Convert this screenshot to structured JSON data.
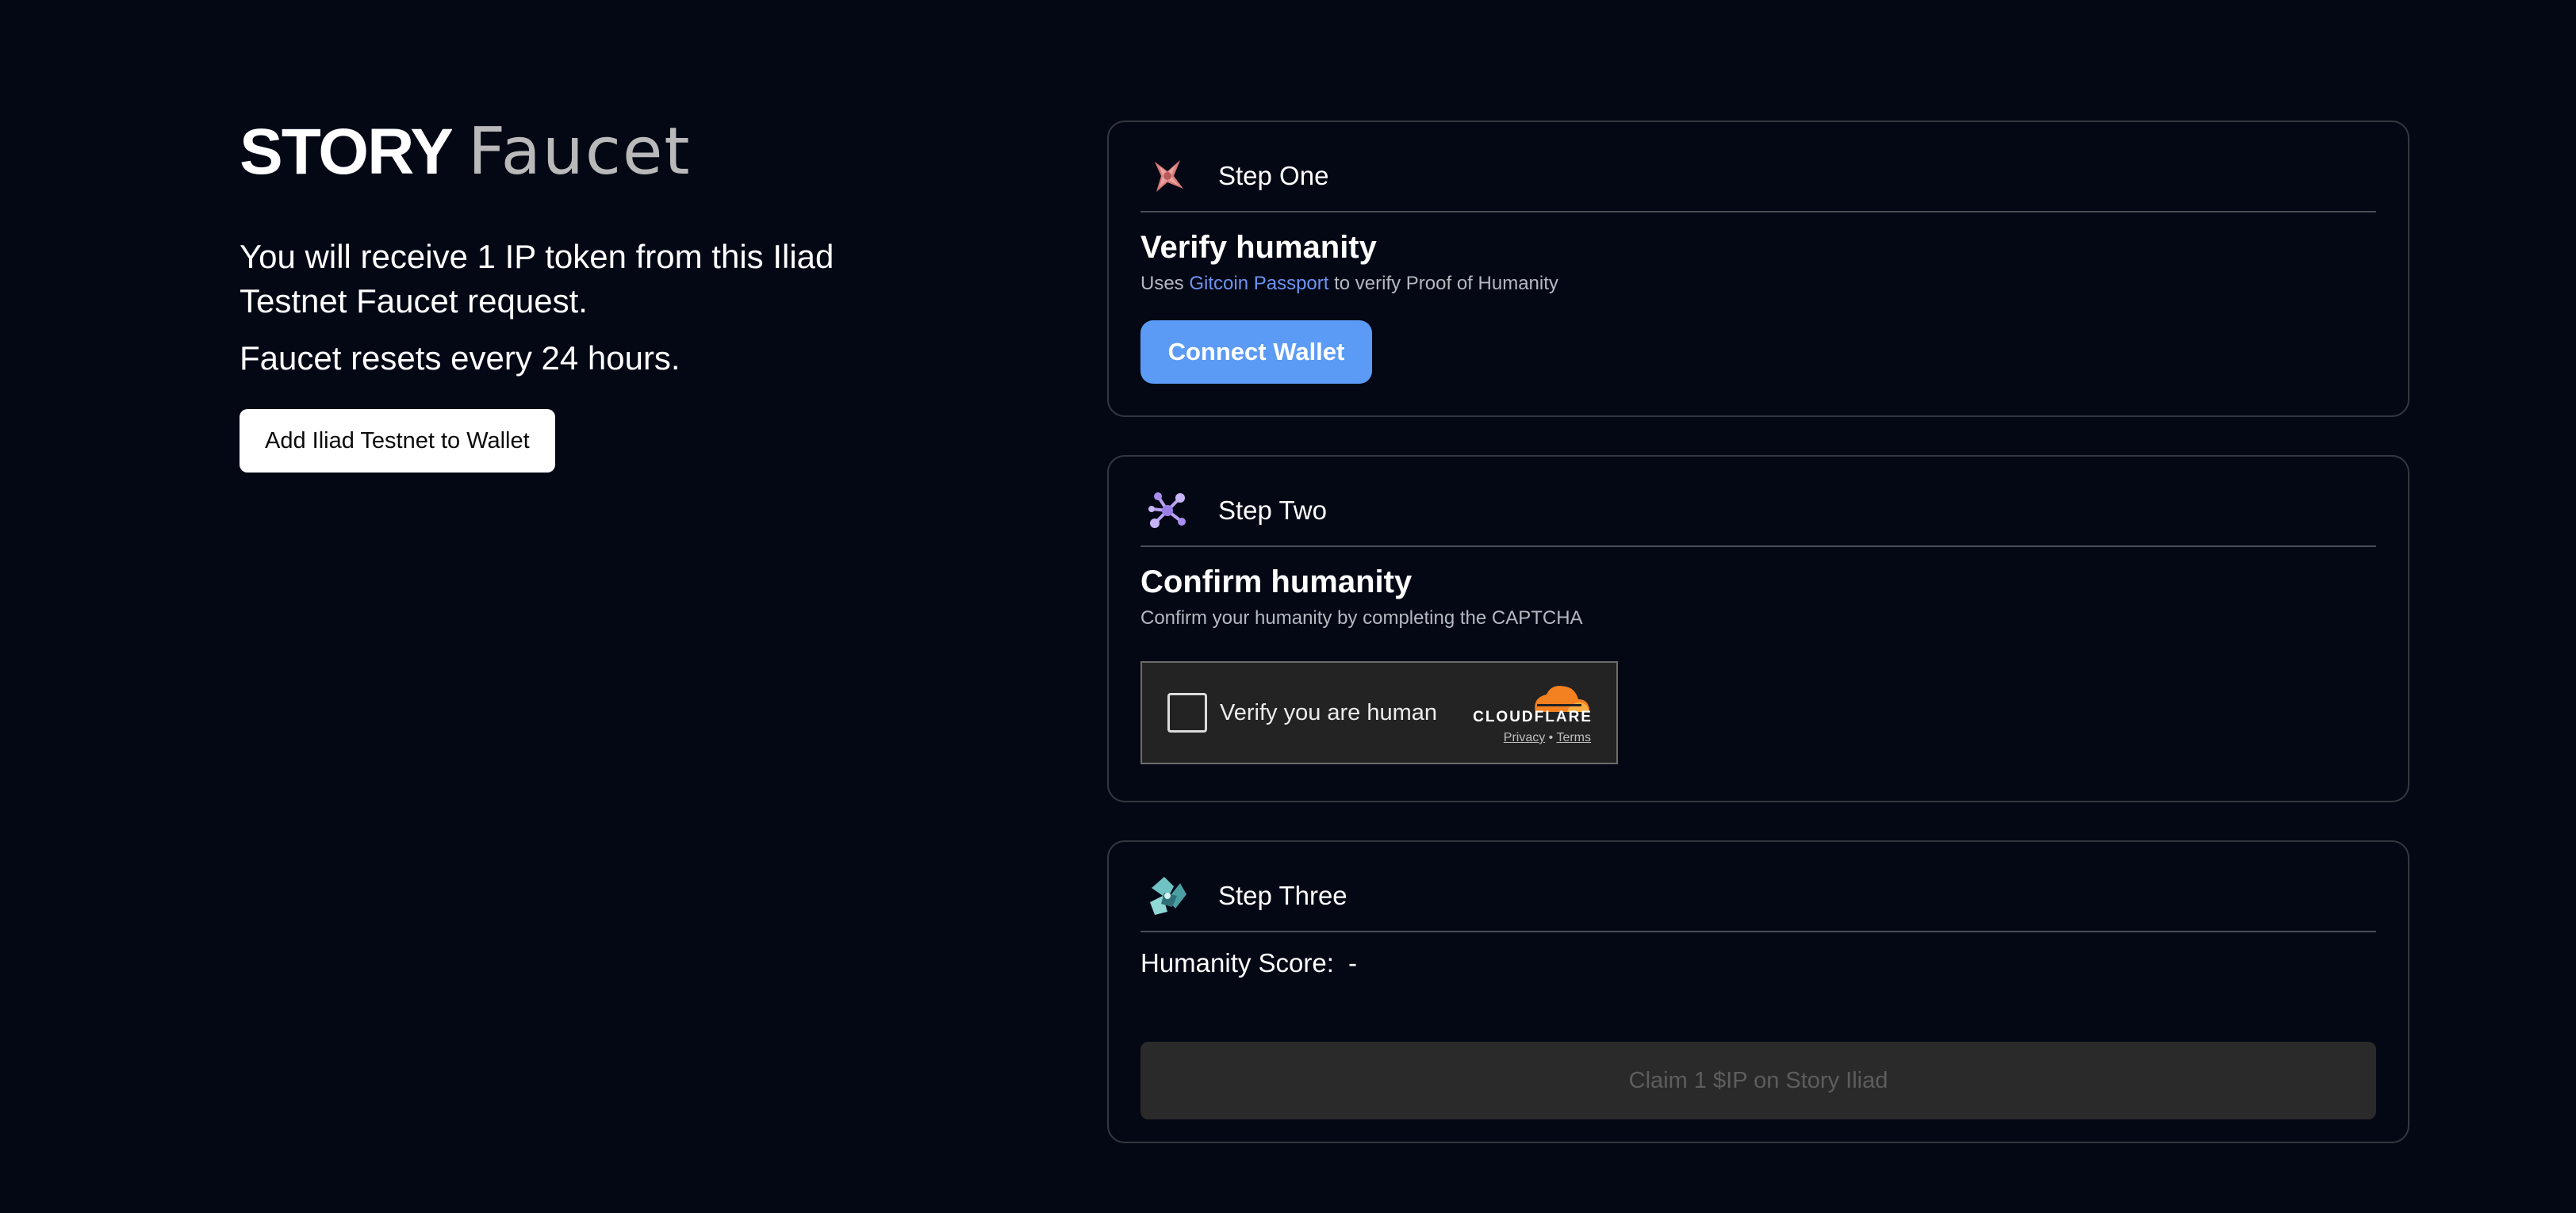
{
  "brand": {
    "name": "STORY",
    "product": "Faucet"
  },
  "intro": {
    "message": "You will receive 1 IP token from this Iliad Testnet Faucet request.",
    "reset_note": "Faucet resets every 24 hours.",
    "add_network_label": "Add Iliad Testnet to Wallet"
  },
  "steps": [
    {
      "label": "Step One",
      "icon": "gitcoin-passport-icon",
      "title": "Verify humanity",
      "subtitle_prefix": "Uses",
      "subtitle_link": "Gitcoin Passport",
      "subtitle_suffix": "to verify Proof of Humanity",
      "button_label": "Connect Wallet"
    },
    {
      "label": "Step Two",
      "icon": "network-nodes-icon",
      "title": "Confirm humanity",
      "subtitle": "Confirm your humanity by completing the CAPTCHA",
      "captcha": {
        "label": "Verify you are human",
        "provider": "CLOUDFLARE",
        "privacy": "Privacy",
        "separator": "•",
        "terms": "Terms"
      }
    },
    {
      "label": "Step Three",
      "icon": "crystal-icon",
      "score_label": "Humanity Score:",
      "score_value": "-",
      "claim_label": "Claim 1 $IP on Story Iliad"
    }
  ],
  "colors": {
    "background": "#040815",
    "accent_blue": "#5b9bf5",
    "link_blue": "#6d93f2",
    "card_border": "#34373f",
    "cloudflare_orange": "#f48120"
  }
}
